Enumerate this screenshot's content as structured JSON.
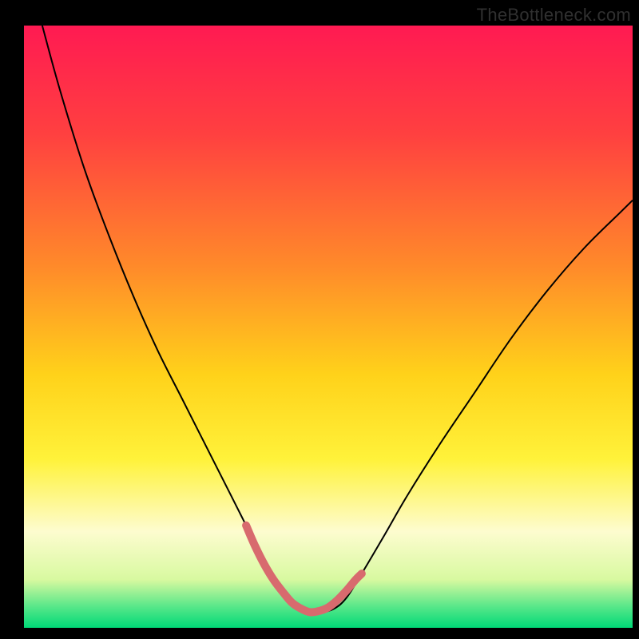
{
  "watermark": "TheBottleneck.com",
  "chart_data": {
    "type": "line",
    "title": "",
    "xlabel": "",
    "ylabel": "",
    "xlim": [
      0,
      100
    ],
    "ylim": [
      0,
      100
    ],
    "grid": false,
    "legend": false,
    "annotations": [],
    "background_gradient": {
      "stops": [
        {
          "offset": 0.0,
          "color": "#ff1a52"
        },
        {
          "offset": 0.18,
          "color": "#ff4040"
        },
        {
          "offset": 0.4,
          "color": "#ff8a2a"
        },
        {
          "offset": 0.58,
          "color": "#ffd21a"
        },
        {
          "offset": 0.72,
          "color": "#fff23a"
        },
        {
          "offset": 0.84,
          "color": "#fdfccf"
        },
        {
          "offset": 0.92,
          "color": "#d8f9a0"
        },
        {
          "offset": 0.965,
          "color": "#57e789"
        },
        {
          "offset": 1.0,
          "color": "#00d977"
        }
      ]
    },
    "series": [
      {
        "name": "bottleneck-curve",
        "color": "#000000",
        "width": 2,
        "x": [
          3,
          6,
          10,
          14,
          18,
          22,
          26,
          30,
          34,
          36.5,
          39,
          41,
          43,
          45,
          47,
          49,
          51,
          53,
          55.5,
          59,
          63,
          68,
          74,
          80,
          86,
          92,
          98,
          100
        ],
        "y": [
          100,
          89,
          76,
          65,
          55,
          46,
          38,
          30,
          22,
          17,
          12,
          8,
          5,
          3.2,
          2.6,
          2.6,
          3.2,
          5,
          9,
          15,
          22,
          30,
          39,
          48,
          56,
          63,
          69,
          71
        ]
      },
      {
        "name": "valley-highlight",
        "color": "#d86a6e",
        "width": 10,
        "linecap": "round",
        "x": [
          36.5,
          38,
          39.5,
          41,
          42.5,
          44,
          45.5,
          47,
          48.5,
          50,
          51.5,
          53,
          54.5,
          55.5
        ],
        "y": [
          17,
          13.5,
          10.5,
          8,
          6,
          4.2,
          3.2,
          2.6,
          2.8,
          3.4,
          4.6,
          6.2,
          8,
          9
        ]
      }
    ]
  }
}
